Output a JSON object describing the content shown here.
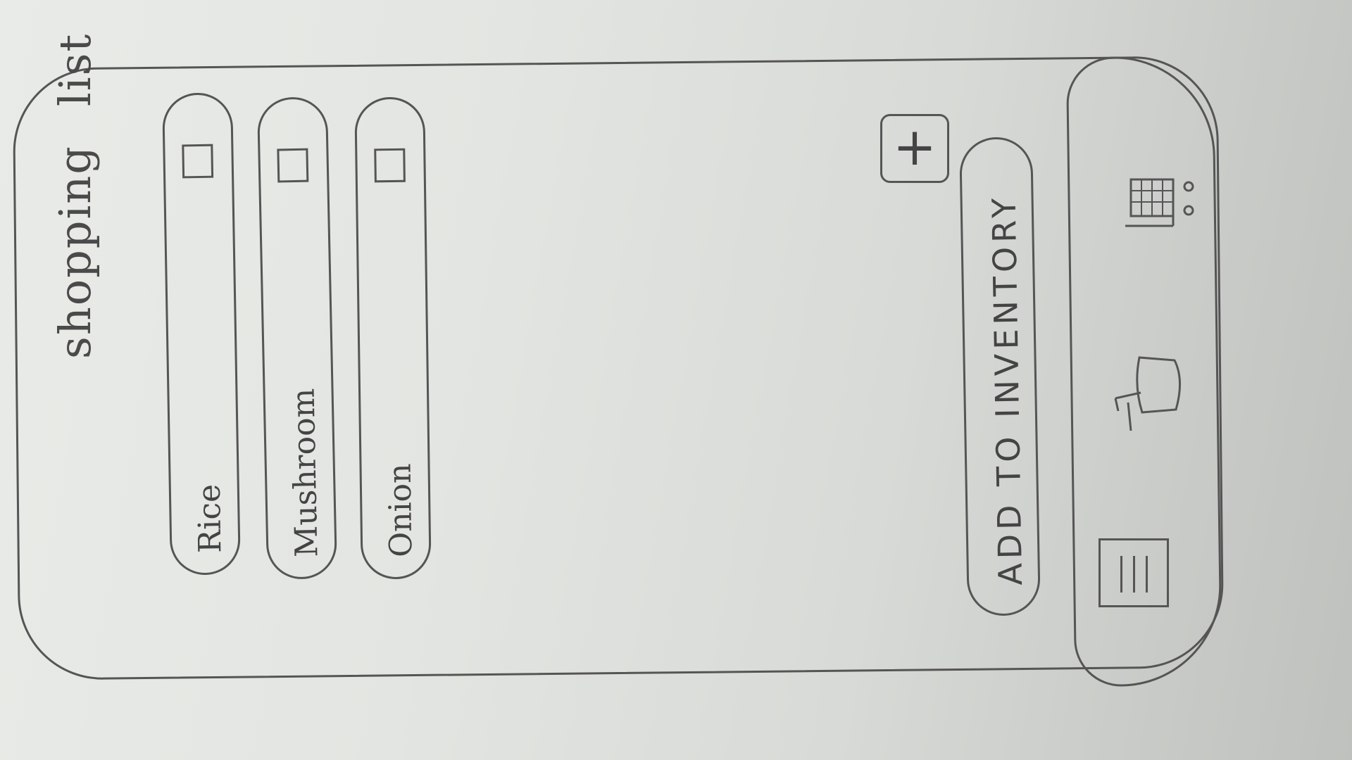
{
  "screen": {
    "title_word_1": "shopping",
    "title_word_2": "list"
  },
  "items": [
    {
      "label": "Rice",
      "checked": false
    },
    {
      "label": "Mushroom",
      "checked": false
    },
    {
      "label": "Onion",
      "checked": false
    }
  ],
  "add_item": {
    "glyph": "+"
  },
  "primary_action": {
    "label": "ADD TO INVENTORY"
  },
  "bottom_nav": {
    "icons": [
      "list-icon",
      "bowl-icon",
      "cart-icon"
    ]
  }
}
